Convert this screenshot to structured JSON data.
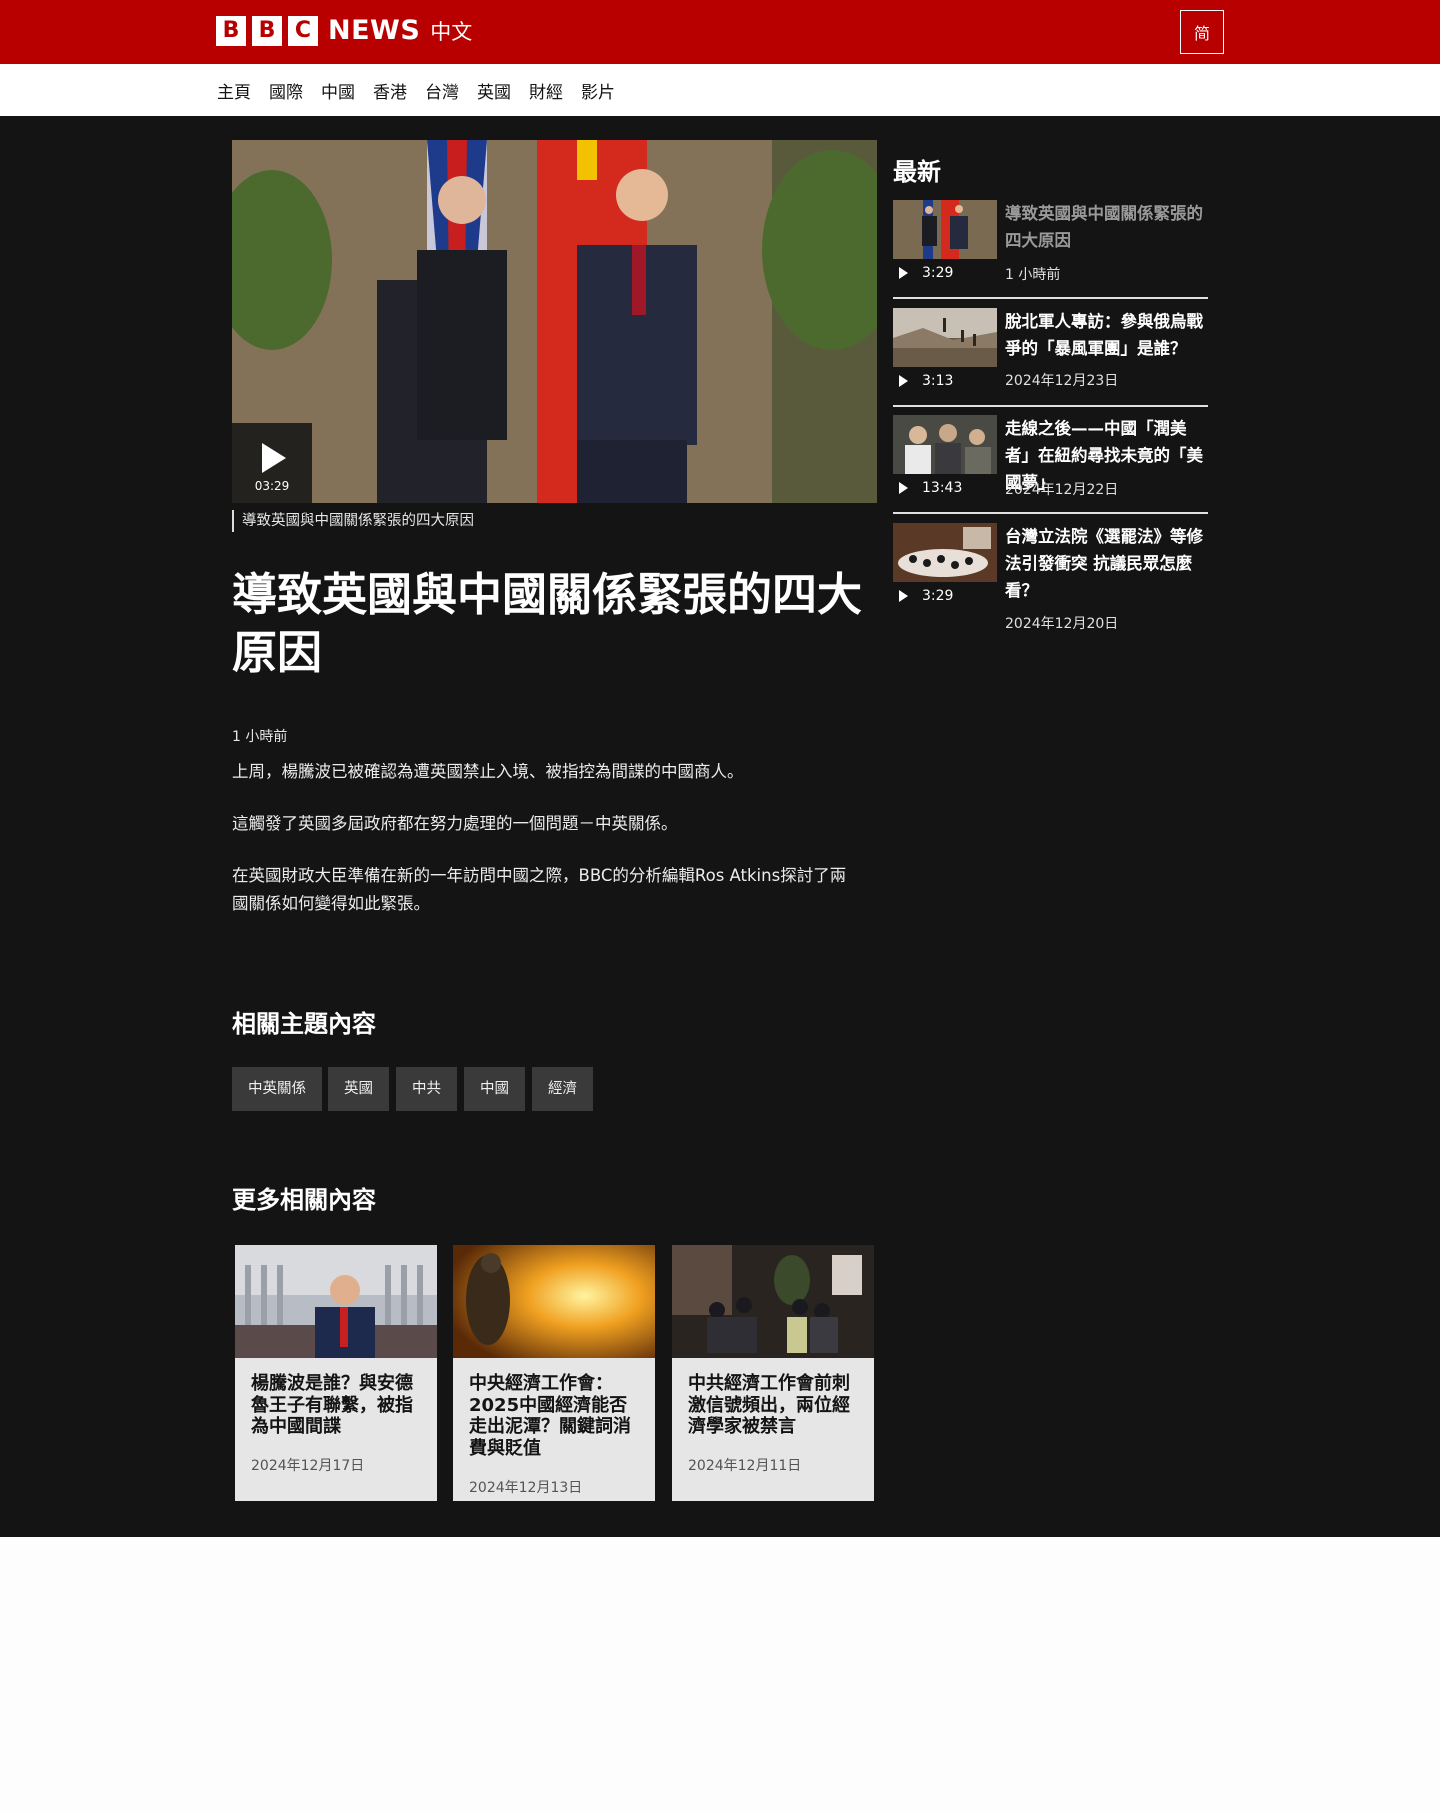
{
  "header": {
    "logo_letters": [
      "B",
      "B",
      "C"
    ],
    "logo_news": "NEWS",
    "logo_lang": "中文",
    "lang_toggle": "简"
  },
  "nav": {
    "items": [
      "主頁",
      "國際",
      "中國",
      "香港",
      "台灣",
      "英國",
      "財經",
      "影片"
    ]
  },
  "video": {
    "duration": "03:29",
    "caption": "導致英國與中國關係緊張的四大原因"
  },
  "article": {
    "headline": "導致英國與中國關係緊張的四大原因",
    "timestamp": "1 小時前",
    "paragraphs": [
      "上周，楊騰波已被確認為遭英國禁止入境、被指控為間諜的中國商人。",
      "這觸發了英國多屆政府都在努力處理的一個問題－中英關係。",
      "在英國財政大臣準備在新的一年訪問中國之際，BBC的分析編輯Ros Atkins探討了兩國關係如何變得如此緊張。"
    ]
  },
  "topics": {
    "title": "相關主題內容",
    "tags": [
      "中英關係",
      "英國",
      "中共",
      "中國",
      "經濟"
    ]
  },
  "more": {
    "title": "更多相關內容",
    "cards": [
      {
        "title": "楊騰波是誰？與安德魯王子有聯繫，被指為中國間諜",
        "date": "2024年12月17日"
      },
      {
        "title": "中央經濟工作會：2025中國經濟能否走出泥潭？關鍵詞消費與貶值",
        "date": "2024年12月13日"
      },
      {
        "title": "中共經濟工作會前刺激信號頻出，兩位經濟學家被禁言",
        "date": "2024年12月11日"
      }
    ]
  },
  "latest": {
    "title": "最新",
    "items": [
      {
        "title": "導致英國與中國關係緊張的四大原因",
        "duration": "3:29",
        "date": "1 小時前"
      },
      {
        "title": "脫北軍人專訪：參與俄烏戰爭的「暴風軍團」是誰？",
        "duration": "3:13",
        "date": "2024年12月23日"
      },
      {
        "title": "走線之後——中國「潤美者」在紐約尋找未竟的「美國夢」",
        "duration": "13:43",
        "date": "2024年12月22日"
      },
      {
        "title": "台灣立法院《選罷法》等修法引發衝突 抗議民眾怎麼看？",
        "duration": "3:29",
        "date": "2024年12月20日"
      }
    ]
  },
  "colors": {
    "brand_red": "#b80000",
    "page_dark": "#141414",
    "tag_bg": "#3a3a3a",
    "card_bg": "#e6e6e6"
  }
}
